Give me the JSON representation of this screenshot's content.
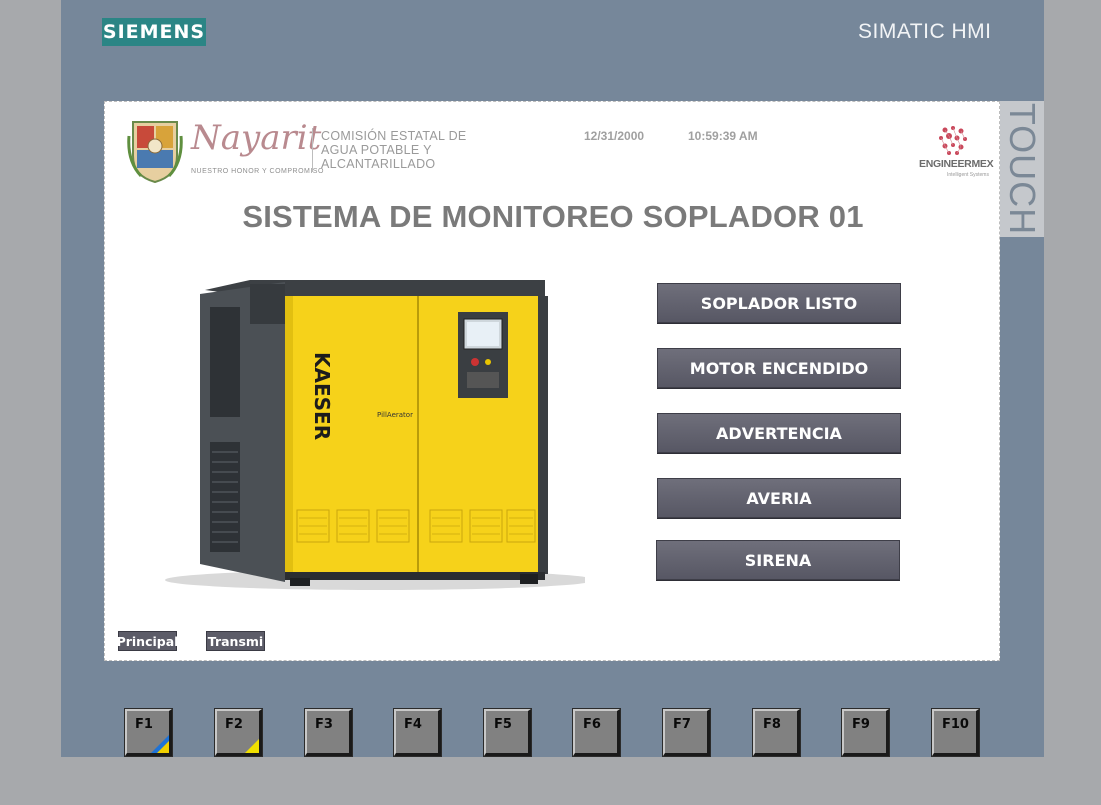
{
  "device": {
    "brand": "SIEMENS",
    "model": "SIMATIC HMI",
    "touch_label": "TOUCH"
  },
  "header": {
    "nayarit_logo": "Nayarit",
    "nayarit_tagline": "NUESTRO HONOR Y COMPROMISO",
    "agency_lines": [
      "COMISIÓN ESTATAL DE",
      "AGUA POTABLE Y",
      "ALCANTARILLADO"
    ],
    "date": "12/31/2000",
    "time": "10:59:39 AM",
    "engineermex": "ENGINEERMEX",
    "engineermex_sub": "Intelligent Systems"
  },
  "title": "SISTEMA DE MONITOREO SOPLADOR 01",
  "machine": {
    "brand": "KAESER",
    "model": "PillAerator",
    "body_color": "#f6d21a"
  },
  "status_buttons": [
    {
      "label": "SOPLADOR LISTO"
    },
    {
      "label": "MOTOR ENCENDIDO"
    },
    {
      "label": "ADVERTENCIA"
    },
    {
      "label": "AVERIA"
    },
    {
      "label": "SIRENA"
    }
  ],
  "nav": {
    "principal": "Principal",
    "transmi": "Transmi"
  },
  "function_keys": [
    "F1",
    "F2",
    "F3",
    "F4",
    "F5",
    "F6",
    "F7",
    "F8",
    "F9",
    "F10"
  ],
  "colors": {
    "bezel": "#76879a",
    "outer": "#a7a9ac",
    "siemens": "#2b8585",
    "button": "#5f5f6b"
  }
}
